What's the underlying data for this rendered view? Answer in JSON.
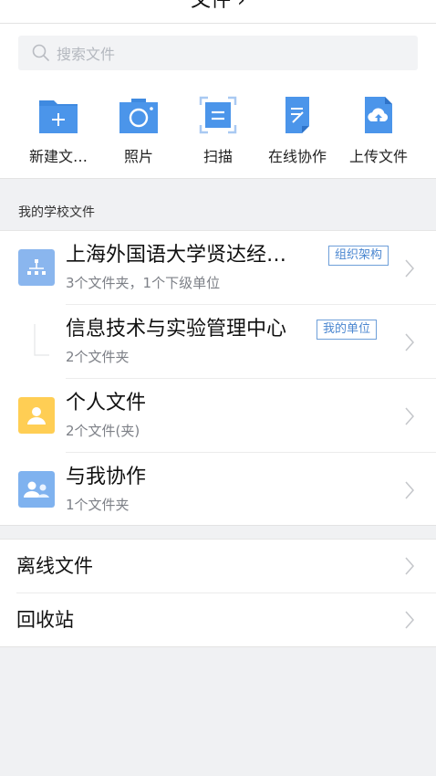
{
  "header": {
    "title": "文件 ›"
  },
  "search": {
    "placeholder": "搜索文件"
  },
  "actions": [
    {
      "label": "新建文…",
      "icon": "new-folder-icon"
    },
    {
      "label": "照片",
      "icon": "camera-icon"
    },
    {
      "label": "扫描",
      "icon": "scan-icon"
    },
    {
      "label": "在线协作",
      "icon": "online-doc-icon"
    },
    {
      "label": "上传文件",
      "icon": "upload-cloud-icon"
    }
  ],
  "school_section": {
    "label": "我的学校文件",
    "items": [
      {
        "title": "上海外国语大学贤达经…",
        "subtitle": "3个文件夹，1个下级单位",
        "badge": "组织架构",
        "icon": "org-tree-icon"
      },
      {
        "title": "信息技术与实验管理中心",
        "subtitle": "2个文件夹",
        "badge": "我的单位",
        "icon": "unit-icon"
      },
      {
        "title": "个人文件",
        "subtitle": "2个文件(夹)",
        "badge": "",
        "icon": "person-icon"
      },
      {
        "title": "与我协作",
        "subtitle": "1个文件夹",
        "badge": "",
        "icon": "group-icon"
      }
    ]
  },
  "other": [
    {
      "title": "离线文件"
    },
    {
      "title": "回收站"
    }
  ],
  "colors": {
    "blue_icon": "#3f8ae0",
    "badge": "#4a86d0",
    "yellow_icon": "#ffce54",
    "light_blue_icon": "#7fb2ef"
  }
}
